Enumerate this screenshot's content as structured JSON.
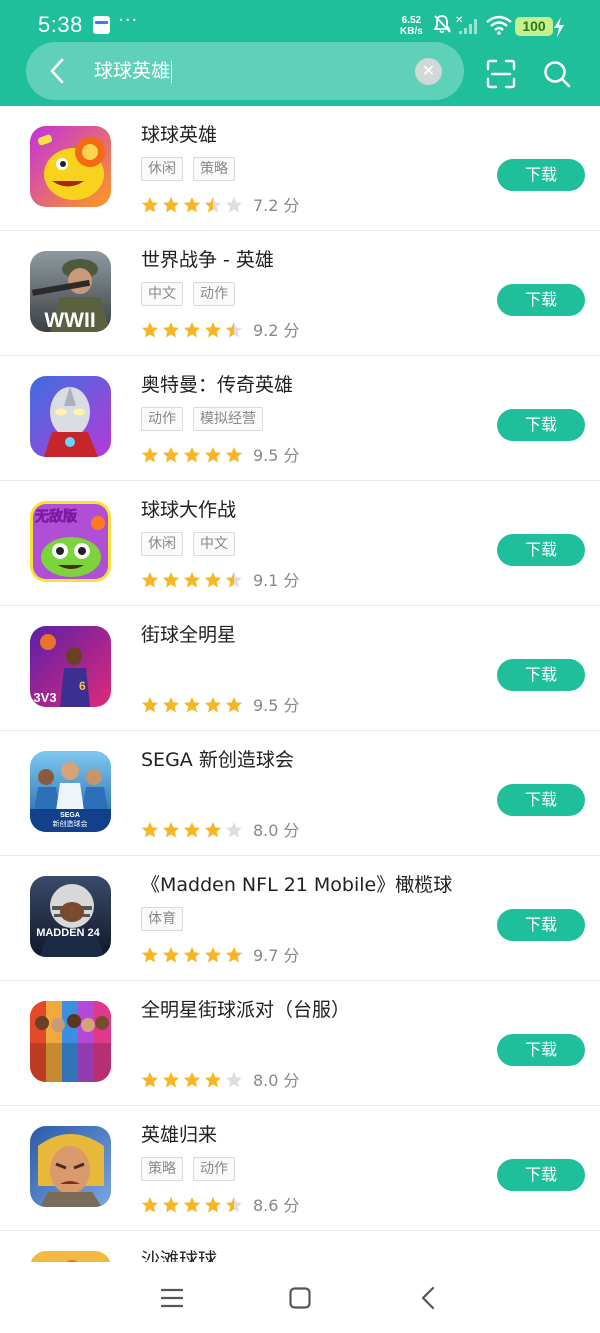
{
  "status_bar": {
    "time": "5:38",
    "net_speed_value": "6.52",
    "net_speed_unit": "KB/s",
    "battery": "100"
  },
  "search": {
    "query": "球球英雄"
  },
  "download_label": "下载",
  "score_unit": "分",
  "apps": [
    {
      "title": "球球英雄",
      "tags": [
        "休闲",
        "策略"
      ],
      "rating": 3.5,
      "score": "7.2",
      "icon": "cartoon-ball-hero-icon"
    },
    {
      "title": "世界战争 - 英雄",
      "tags": [
        "中文",
        "动作"
      ],
      "rating": 4.5,
      "score": "9.2",
      "icon": "ww2-soldier-icon"
    },
    {
      "title": "奥特曼：传奇英雄",
      "tags": [
        "动作",
        "模拟经营"
      ],
      "rating": 5,
      "score": "9.5",
      "icon": "ultraman-icon"
    },
    {
      "title": "球球大作战",
      "tags": [
        "休闲",
        "中文"
      ],
      "rating": 4.5,
      "score": "9.1",
      "icon": "ball-battle-icon"
    },
    {
      "title": "街球全明星",
      "tags": [],
      "rating": 5,
      "score": "9.5",
      "icon": "streetball-icon"
    },
    {
      "title": "SEGA 新创造球会",
      "tags": [],
      "rating": 4,
      "score": "8.0",
      "icon": "sega-soccer-icon"
    },
    {
      "title": "《Madden NFL 21 Mobile》橄榄球",
      "tags": [
        "体育"
      ],
      "rating": 5,
      "score": "9.7",
      "icon": "madden-football-icon"
    },
    {
      "title": "全明星街球派对（台服）",
      "tags": [],
      "rating": 4,
      "score": "8.0",
      "icon": "basketball-party-icon"
    },
    {
      "title": "英雄归来",
      "tags": [
        "策略",
        "动作"
      ],
      "rating": 4.5,
      "score": "8.6",
      "icon": "hero-warrior-icon"
    }
  ],
  "partial_app": {
    "title": "沙滩球球",
    "icon": "beach-ball-icon"
  },
  "icon_art_text": {
    "ww2": "WWII",
    "ball_battle": "无敌版",
    "streetball": "3V3",
    "sega_brand": "SEGA",
    "sega_game": "新创造球会",
    "madden": "MADDEN 24"
  },
  "colors": {
    "accent": "#1fbf9c",
    "star": "#f8b722",
    "star_empty": "#dedede"
  }
}
